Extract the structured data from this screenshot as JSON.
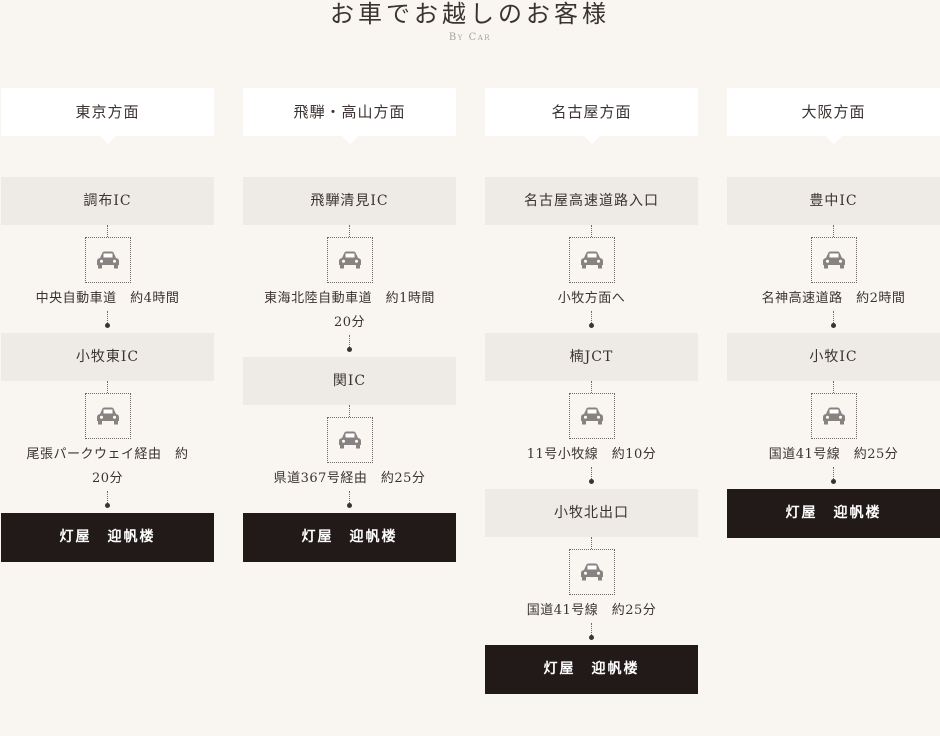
{
  "section": {
    "title": "お車でお越しのお客様",
    "subtitle": "By Car"
  },
  "columns": [
    {
      "heading": "東京方面",
      "steps": [
        {
          "place": "調布IC",
          "route": [
            "中央自動車道　約4時間"
          ]
        },
        {
          "place": "小牧東IC",
          "route": [
            "尾張パークウェイ経由　約",
            "20分"
          ]
        }
      ],
      "destination": "灯屋　迎帆楼"
    },
    {
      "heading": "飛騨・高山方面",
      "steps": [
        {
          "place": "飛騨清見IC",
          "route": [
            "東海北陸自動車道　約1時間",
            "20分"
          ]
        },
        {
          "place": "関IC",
          "route": [
            "県道367号経由　約25分"
          ]
        }
      ],
      "destination": "灯屋　迎帆楼"
    },
    {
      "heading": "名古屋方面",
      "steps": [
        {
          "place": "名古屋高速道路入口",
          "route": [
            "小牧方面へ"
          ]
        },
        {
          "place": "楠JCT",
          "route": [
            "11号小牧線　約10分"
          ]
        },
        {
          "place": "小牧北出口",
          "route": [
            "国道41号線　約25分"
          ]
        }
      ],
      "destination": "灯屋　迎帆楼"
    },
    {
      "heading": "大阪方面",
      "steps": [
        {
          "place": "豊中IC",
          "route": [
            "名神高速道路　約2時間"
          ]
        },
        {
          "place": "小牧IC",
          "route": [
            "国道41号線　約25分"
          ]
        }
      ],
      "destination": "灯屋　迎帆楼"
    }
  ],
  "icons": {
    "vehicle": "car-icon",
    "line_color": "#6f6864",
    "place_bg": "#eeebe7",
    "destination_bg": "#221a18",
    "page_bg": "#f9f6f2"
  }
}
